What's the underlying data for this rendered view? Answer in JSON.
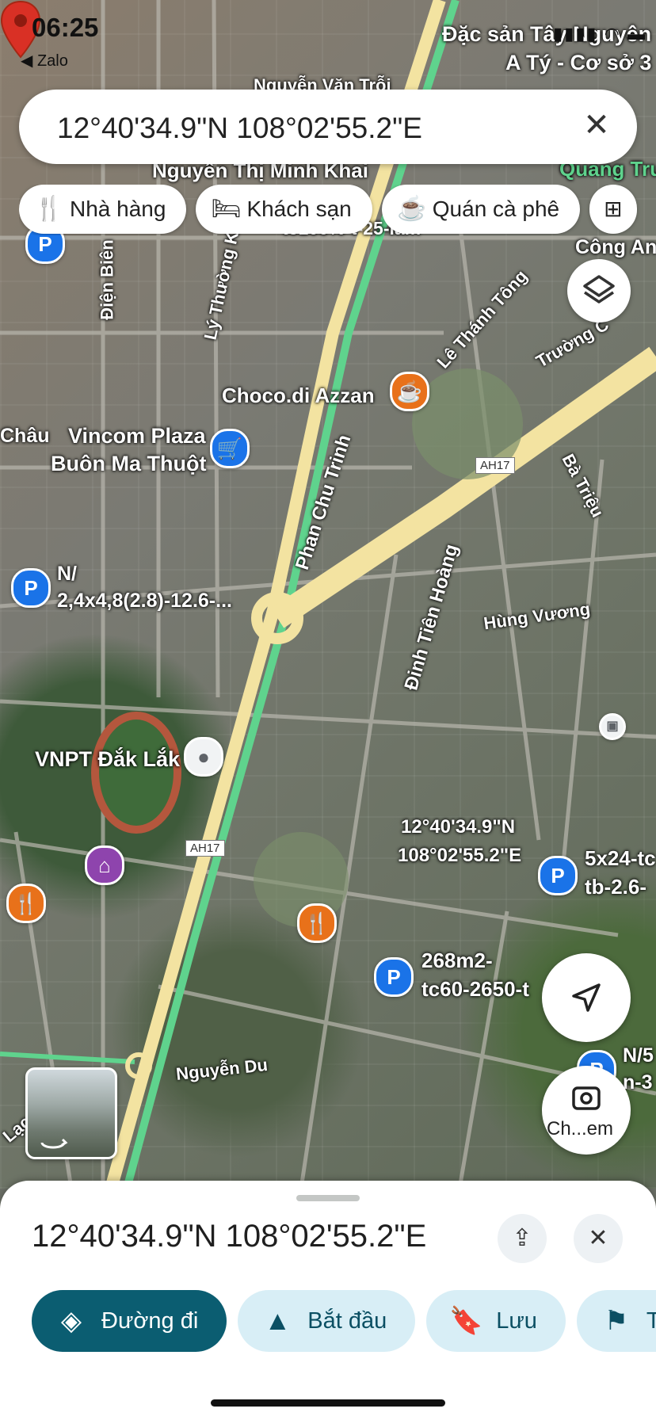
{
  "status_bar": {
    "time": "06:25",
    "back_app": "◀ Zalo"
  },
  "search": {
    "query": "12°40'34.9\"N 108°02'55.2\"E",
    "clear_icon": "close-icon"
  },
  "chips": [
    {
      "label": "Nhà hàng",
      "icon": "restaurant-icon"
    },
    {
      "label": "Khách sạn",
      "icon": "hotel-icon"
    },
    {
      "label": "Quán cà phê",
      "icon": "coffee-icon"
    }
  ],
  "map": {
    "places": {
      "dac_san_line1": "Đặc sản Tây Nguyên",
      "dac_san_line2": "A Tý - Cơ sở 3",
      "choco": "Choco.di Azzan",
      "vincom_line1": "Vincom Plaza",
      "vincom_line2": "Buôn Ma Thuột",
      "chau": "Châu",
      "vnpt": "VNPT Đắk Lắk",
      "quang_tru": "Quang Tru",
      "cong_an": "Công An",
      "n24_line1": "N/",
      "n24_line2": "2,4x4,8(2.8)-12.6-...",
      "tc100": "tc100%-t-25-lam",
      "p268_line1": "268m2-",
      "p268_line2": "tc60-2650-t",
      "p5x24_line1": "5x24-tc",
      "p5x24_line2": "tb-2.6-",
      "pn5_line1": "N/5",
      "pn5_line2": "n-3"
    },
    "streets": {
      "nguyen_van_troi": "Nguyễn Văn Trỗi",
      "nguyen_thi_minh_khai": "Nguyễn Thị Minh Khai",
      "dien_bien": "Điện Biên",
      "ly_thuong_kiet": "Lý Thường Kiệt",
      "le_thanh_tong": "Lê Thánh Tông",
      "truong_chinh": "Trường C",
      "ba_trieu": "Bà Triệu",
      "phan_chu_trinh": "Phan Chu Trinh",
      "dinh_tien_hoang": "Đinh Tiên Hoàng",
      "hung_vuong": "Hùng Vương",
      "nguyen_du": "Nguyễn Du",
      "lac_d": "Lạc Đ"
    },
    "highway_shields": [
      "AH17",
      "AH17"
    ],
    "dropped_pin": {
      "lat": "12°40'34.9\"N",
      "lng": "108°02'55.2\"E"
    }
  },
  "buttons": {
    "layers_icon": "layers-icon",
    "locate_icon": "navigation-arrow-icon",
    "camera_label": "Ch...em"
  },
  "sheet": {
    "title": "12°40'34.9\"N 108°02'55.2\"E",
    "share_icon": "share-icon",
    "close_icon": "close-icon",
    "actions": [
      {
        "label": "Đường đi",
        "icon": "directions-icon",
        "style": "primary"
      },
      {
        "label": "Bắt đầu",
        "icon": "navigation-icon",
        "style": "secondary"
      },
      {
        "label": "Lưu",
        "icon": "bookmark-icon",
        "style": "secondary"
      },
      {
        "label": "T",
        "icon": "flag-icon",
        "style": "secondary"
      }
    ]
  },
  "colors": {
    "primary_action": "#0b5d71",
    "secondary_action": "#d8eef6",
    "pin_red": "#d93025",
    "poi_blue": "#1a73e8",
    "highway_yellow": "#f3e3a1",
    "highway_green": "#5fd38d"
  }
}
